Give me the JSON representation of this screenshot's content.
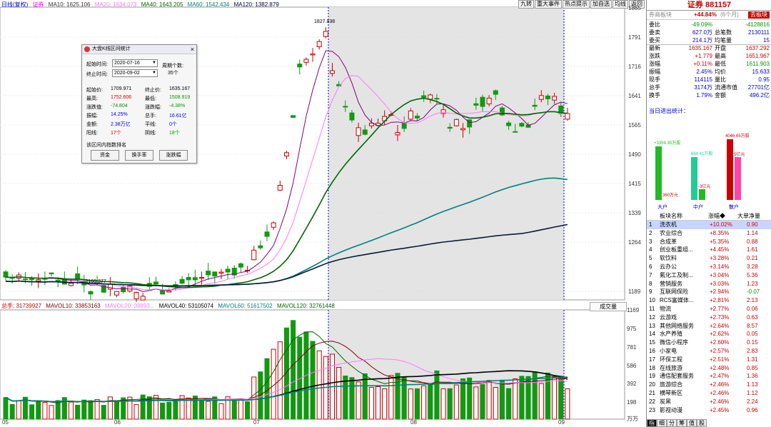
{
  "ma_legend": {
    "prefix": "日线(复权)",
    "items": [
      {
        "label": "证券",
        "color": "#ff00ff"
      },
      {
        "label": "MA10: 1625.106",
        "color": "#333333"
      },
      {
        "label": "MA20: 1634.073",
        "color": "#ff77ff"
      },
      {
        "label": "MA40: 1643.205",
        "color": "#006600"
      },
      {
        "label": "MA60: 1542.434",
        "color": "#008080"
      },
      {
        "label": "MA120: 1382.879",
        "color": "#000033"
      }
    ]
  },
  "top_buttons": [
    "九转",
    "重大事件",
    "热点提示",
    "加自选",
    "均线",
    "返回"
  ],
  "price_axis": [
    "1865",
    "1791",
    "1716",
    "1641",
    "1565",
    "1490",
    "1415",
    "1339",
    "1264",
    "1189"
  ],
  "price_annotations": {
    "high": "1827.838",
    "low": "1160.377"
  },
  "vol_legend": {
    "items": [
      {
        "label": "总手: 31739927",
        "color": "#cc0000"
      },
      {
        "label": "MAVOL10: 33853163",
        "color": "#800000"
      },
      {
        "label": "MAVOL20: 39893...",
        "color": "#ff77ff"
      },
      {
        "label": "MAVOL40: 53105074",
        "color": "#000000"
      },
      {
        "label": "MAVOL60: 51617502",
        "color": "#008080"
      },
      {
        "label": "MAVOL120: 32761448",
        "color": "#006600"
      }
    ]
  },
  "vol_axis": [
    "1169",
    "975",
    "781",
    "586",
    "392",
    "198"
  ],
  "vol_unit": "万万",
  "chengjiao_label": "成交量",
  "x_labels": [
    "05",
    "06",
    "07",
    "08",
    "09"
  ],
  "dialog": {
    "title": "大盘K线区间统计",
    "start_label": "起始时间:",
    "start_value": "2020-07-16",
    "end_label": "终止时间:",
    "end_value": "2020-09-02",
    "period_label": "周期个数:",
    "period_value": "35个",
    "stats": [
      {
        "l1": "起始价:",
        "v1": "1709.971",
        "c1": "",
        "l2": "终止价:",
        "v2": "1635.167",
        "c2": ""
      },
      {
        "l1": "最高:",
        "v1": "1752.606",
        "c1": "red",
        "l2": "最低:",
        "v2": "1508.919",
        "c2": "green"
      },
      {
        "l1": "涨跌值:",
        "v1": "-74.804",
        "c1": "green",
        "l2": "涨跌幅:",
        "v2": "-4.38%",
        "c2": "green"
      },
      {
        "l1": "振幅:",
        "v1": "14.25%",
        "c1": "blue",
        "l2": "总手:",
        "v2": "16.61亿",
        "c2": "blue"
      },
      {
        "l1": "金额:",
        "v1": "2.38万亿",
        "c1": "blue",
        "l2": "平线:",
        "v2": "0个",
        "c2": "blue"
      },
      {
        "l1": "阳线:",
        "v1": "17个",
        "c1": "red",
        "l2": "阴线:",
        "v2": "18个",
        "c2": "green"
      }
    ],
    "rank_label": "该区间内指数排名",
    "buttons": [
      "资金",
      "换手率",
      "涨跌幅"
    ]
  },
  "panel": {
    "title": "证券 881157",
    "go_btn": "去板块",
    "subtitle_left": "券商板块",
    "subtitle_mid": "+44.84%",
    "subtitle_right": "(6个月)",
    "quotes": [
      {
        "l": "委比",
        "v": "-49.09%",
        "vc": "green",
        "l2": "",
        "v2": "-4128816",
        "v2c": "green"
      },
      {
        "l": "委卖",
        "v": "627.0万",
        "vc": "blue",
        "l2": "总笔数",
        "v2": "2130111",
        "v2c": "blue"
      },
      {
        "l": "委买",
        "v": "214.1万",
        "vc": "blue",
        "l2": "均笔量",
        "v2": "15",
        "v2c": "blue"
      },
      {
        "l": "最新",
        "v": "1635.167",
        "vc": "red",
        "l2": "开盘",
        "v2": "1637.292",
        "v2c": "red"
      },
      {
        "l": "涨跌",
        "v": "+1.779",
        "vc": "red",
        "l2": "最高",
        "v2": "1651.967",
        "v2c": "red"
      },
      {
        "l": "涨幅",
        "v": "+0.11%",
        "vc": "red",
        "l2": "最低",
        "v2": "1611.903",
        "v2c": "green"
      },
      {
        "l": "振幅",
        "v": "2.45%",
        "vc": "blue",
        "l2": "均价",
        "v2": "15.633",
        "v2c": "blue"
      },
      {
        "l": "现手",
        "v": "114115",
        "vc": "blue",
        "l2": "量比",
        "v2": "0.95",
        "v2c": "blue"
      },
      {
        "l": "总手",
        "v": "3174万",
        "vc": "blue",
        "l2": "流通市值",
        "v2": "27701亿",
        "v2c": "blue"
      },
      {
        "l": "换手",
        "v": "1.79%",
        "vc": "blue",
        "l2": "金额",
        "v2": "496.2亿",
        "v2c": "blue"
      }
    ],
    "flow_title": "当日进出统计：",
    "flow_bars": [
      {
        "name": "大户",
        "pos_label": "+3359.35万股",
        "neg_label": "360万元",
        "pos": 0.75,
        "neg": 0.0,
        "color": "#22bb22"
      },
      {
        "name": "中户",
        "pos_label": "-684.41万股",
        "neg_label": "-3亿元",
        "pos": 0.6,
        "neg": 0.15,
        "color": "#22cc99"
      },
      {
        "name": "散户",
        "pos_label": "4046.65万股",
        "neg_label": "5亿元",
        "pos": 0.85,
        "neg": 0.6,
        "color": "#cc0000"
      }
    ],
    "list_headers": [
      "板块名称",
      "涨幅◆",
      "大单净量"
    ],
    "list": [
      {
        "n": "1",
        "name": "洗衣机",
        "chg": "+10.02%",
        "net": "0.90"
      },
      {
        "n": "2",
        "name": "农业综合",
        "chg": "+8.35%",
        "net": "1.14"
      },
      {
        "n": "3",
        "name": "合成革",
        "chg": "+5.35%",
        "net": "0.88"
      },
      {
        "n": "4",
        "name": "创业板重组...",
        "chg": "+4.45%",
        "net": "1.61"
      },
      {
        "n": "5",
        "name": "软饮料",
        "chg": "+3.28%",
        "net": "0.21"
      },
      {
        "n": "6",
        "name": "云办公",
        "chg": "+3.14%",
        "net": "3.28"
      },
      {
        "n": "7",
        "name": "氟化工及制...",
        "chg": "+3.04%",
        "net": "5.36"
      },
      {
        "n": "8",
        "name": "营销服务",
        "chg": "+3.03%",
        "net": "1.23"
      },
      {
        "n": "9",
        "name": "互联网保险",
        "chg": "+2.94%",
        "net": "-0.07"
      },
      {
        "n": "10",
        "name": "RCS富媒体...",
        "chg": "+2.81%",
        "net": "2.13"
      },
      {
        "n": "11",
        "name": "物流",
        "chg": "+2.77%",
        "net": "0.06"
      },
      {
        "n": "12",
        "name": "云游戏",
        "chg": "+2.73%",
        "net": "0.63"
      },
      {
        "n": "13",
        "name": "其他网络服务",
        "chg": "+2.64%",
        "net": "8.57"
      },
      {
        "n": "14",
        "name": "水产养殖",
        "chg": "+2.62%",
        "net": "0.05"
      },
      {
        "n": "15",
        "name": "微信小程序",
        "chg": "+2.60%",
        "net": "0.15"
      },
      {
        "n": "16",
        "name": "小家电",
        "chg": "+2.57%",
        "net": "2.83"
      },
      {
        "n": "17",
        "name": "环保工程",
        "chg": "+2.51%",
        "net": "1.31"
      },
      {
        "n": "18",
        "name": "在线旅游",
        "chg": "+2.48%",
        "net": "0.85"
      },
      {
        "n": "19",
        "name": "通信配套服务",
        "chg": "+2.47%",
        "net": "1.36"
      },
      {
        "n": "20",
        "name": "旅游综合",
        "chg": "+2.46%",
        "net": "1.13"
      },
      {
        "n": "21",
        "name": "横琴新区",
        "chg": "+2.46%",
        "net": "1.12"
      },
      {
        "n": "22",
        "name": "炭黑",
        "chg": "+2.46%",
        "net": "2.24"
      },
      {
        "n": "23",
        "name": "影视动漫",
        "chg": "+2.45%",
        "net": "0.96"
      }
    ],
    "bottom_tabs": [
      "指",
      "细",
      "分",
      "筹",
      "值",
      "股"
    ]
  },
  "colors": {
    "up": "#cc0000",
    "down": "#119911",
    "shade": "#e4e4e4",
    "sel": "#0000cc"
  }
}
